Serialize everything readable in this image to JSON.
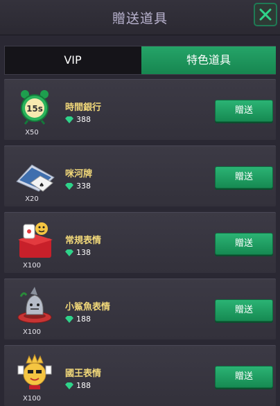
{
  "header": {
    "title": "贈送道具",
    "close_icon": "close-icon"
  },
  "tabs": [
    {
      "label": "VIP",
      "active": false
    },
    {
      "label": "特色道具",
      "active": true
    }
  ],
  "colors": {
    "accent_green": "#1f9a60",
    "name_gold": "#f2d97a",
    "gem": "#2fd38a"
  },
  "items": [
    {
      "name": "時間銀行",
      "price": "388",
      "quantity": "X50",
      "icon": "alarm-clock-icon",
      "button": "贈送"
    },
    {
      "name": "咪河牌",
      "price": "338",
      "quantity": "X20",
      "icon": "playing-cards-icon",
      "button": "贈送"
    },
    {
      "name": "常規表情",
      "price": "138",
      "quantity": "X100",
      "icon": "emoji-pack-icon",
      "button": "贈送"
    },
    {
      "name": "小鯊魚表情",
      "price": "188",
      "quantity": "X100",
      "icon": "shark-emoji-icon",
      "button": "贈送"
    },
    {
      "name": "國王表情",
      "price": "188",
      "quantity": "X100",
      "icon": "king-emoji-icon",
      "button": "贈送"
    }
  ]
}
